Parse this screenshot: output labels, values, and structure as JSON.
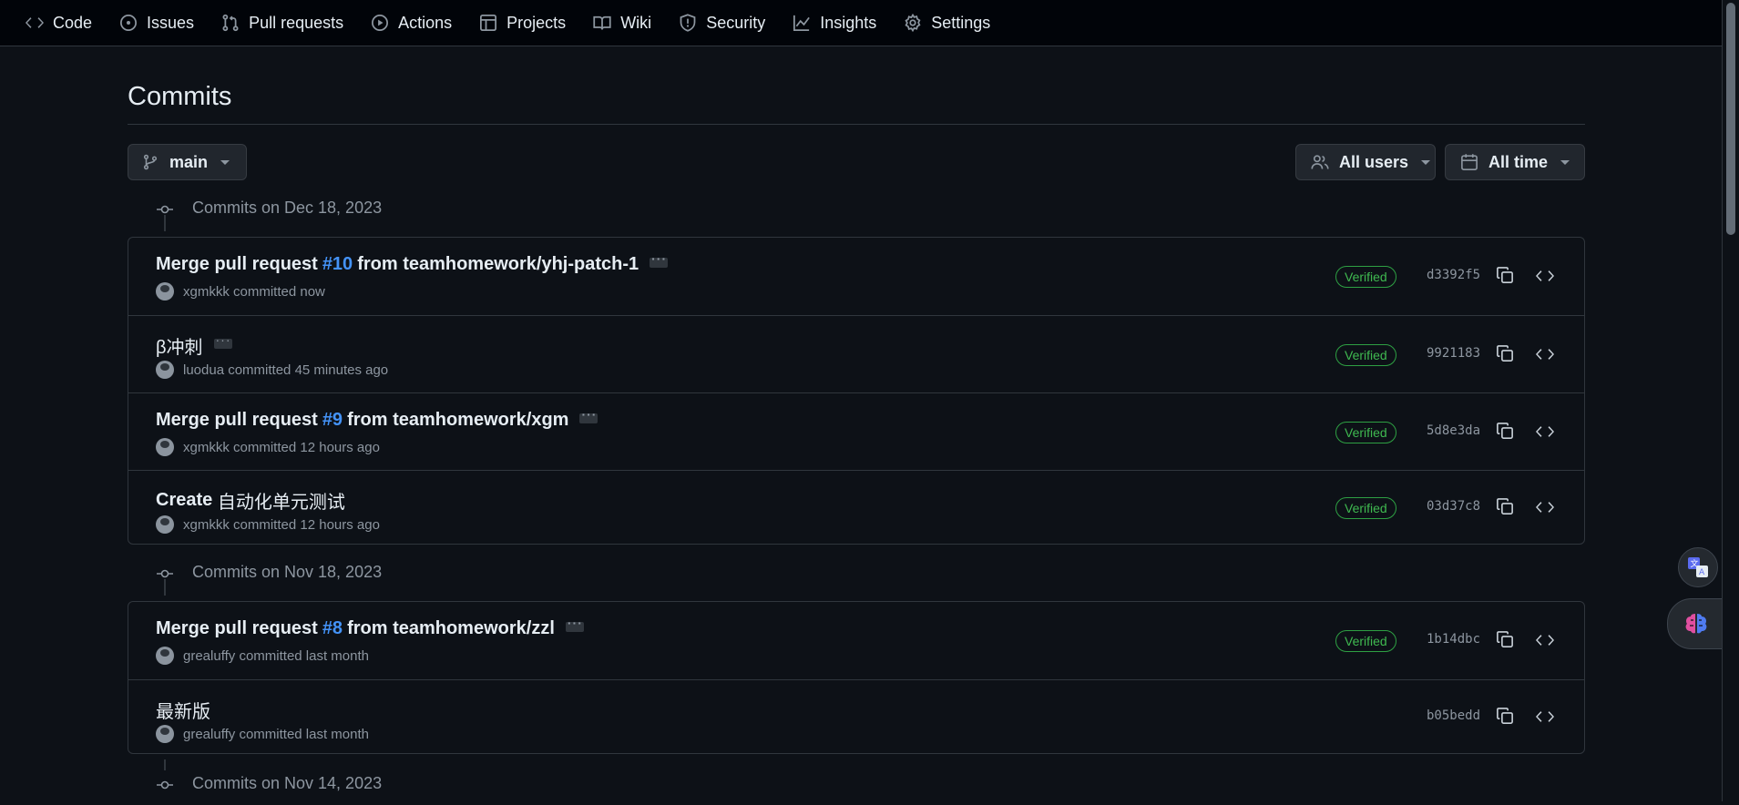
{
  "nav": {
    "tabs": [
      {
        "label": "Code",
        "icon": "code-icon"
      },
      {
        "label": "Issues",
        "icon": "issue-icon"
      },
      {
        "label": "Pull requests",
        "icon": "pull-request-icon"
      },
      {
        "label": "Actions",
        "icon": "play-icon"
      },
      {
        "label": "Projects",
        "icon": "table-icon"
      },
      {
        "label": "Wiki",
        "icon": "book-icon"
      },
      {
        "label": "Security",
        "icon": "shield-icon"
      },
      {
        "label": "Insights",
        "icon": "graph-icon"
      },
      {
        "label": "Settings",
        "icon": "gear-icon"
      }
    ]
  },
  "page": {
    "title": "Commits"
  },
  "filters": {
    "branch": "main",
    "users": "All users",
    "time": "All time"
  },
  "groups": [
    {
      "date_label": "Commits on Dec 18, 2023",
      "commits": [
        {
          "msg_prefix": "Merge pull request ",
          "pr": "#10",
          "msg_suffix": " from teamhomework/yhj-patch-1",
          "author": "xgmkkk",
          "action": "committed",
          "time": "now",
          "verified": "Verified",
          "sha": "d3392f5"
        },
        {
          "msg_prefix": "β冲刺",
          "pr": "",
          "msg_suffix": "",
          "author": "luodua",
          "action": "committed",
          "time": "45 minutes ago",
          "verified": "Verified",
          "sha": "9921183"
        },
        {
          "msg_prefix": "Merge pull request ",
          "pr": "#9",
          "msg_suffix": " from teamhomework/xgm",
          "author": "xgmkkk",
          "action": "committed",
          "time": "12 hours ago",
          "verified": "Verified",
          "sha": "5d8e3da"
        },
        {
          "msg_prefix": "Create ",
          "pr": "",
          "msg_suffix": "自动化单元测试",
          "author": "xgmkkk",
          "action": "committed",
          "time": "12 hours ago",
          "verified": "Verified",
          "sha": "03d37c8"
        }
      ]
    },
    {
      "date_label": "Commits on Nov 18, 2023",
      "commits": [
        {
          "msg_prefix": "Merge pull request ",
          "pr": "#8",
          "msg_suffix": " from teamhomework/zzl",
          "author": "grealuffy",
          "action": "committed",
          "time": "last month",
          "verified": "Verified",
          "sha": "1b14dbc"
        },
        {
          "msg_prefix": "最新版",
          "pr": "",
          "msg_suffix": "",
          "author": "grealuffy",
          "action": "committed",
          "time": "last month",
          "verified": "",
          "sha": "b05bedd"
        }
      ]
    },
    {
      "date_label": "Commits on Nov 14, 2023"
    }
  ],
  "colors": {
    "background": "#0d1117",
    "link": "#4493f8",
    "verified": "#3fb950",
    "muted": "#8d96a0"
  }
}
